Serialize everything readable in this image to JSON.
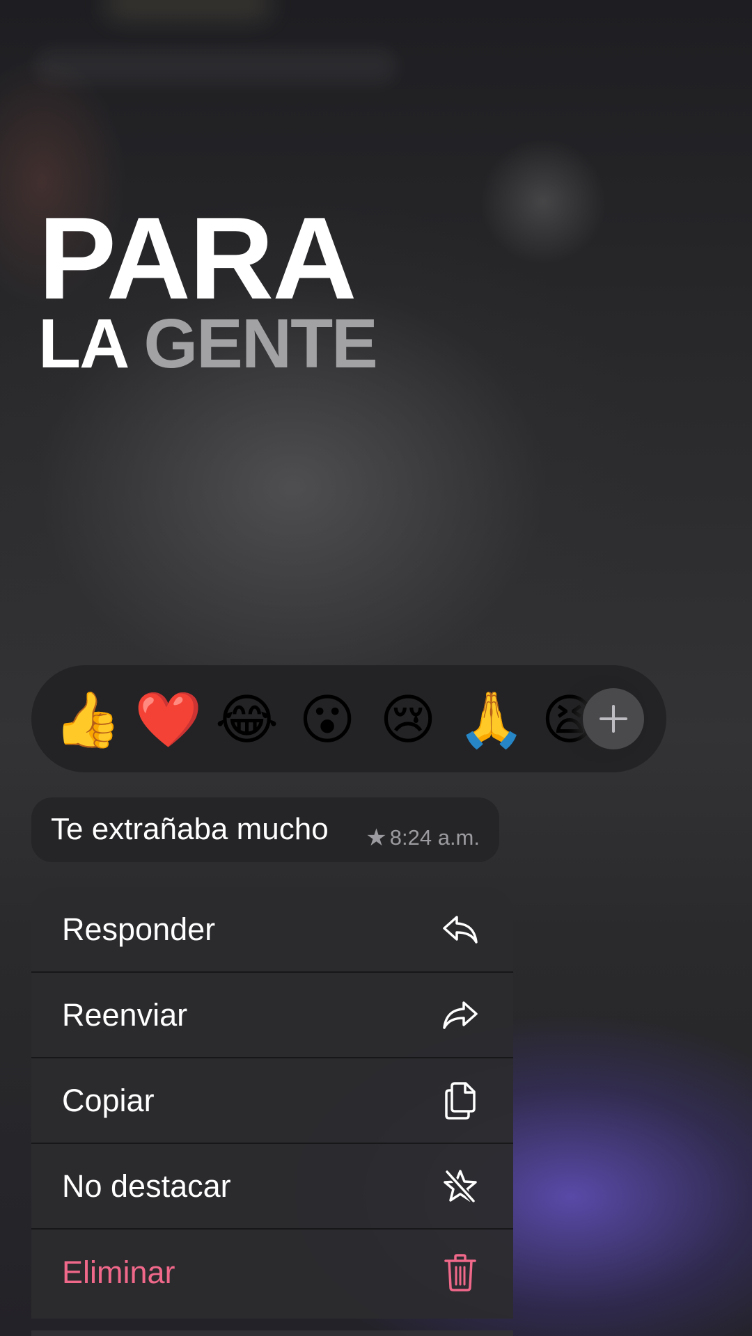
{
  "headline": {
    "line1": "PARA",
    "line2_a": "LA",
    "line2_b": "GENTE"
  },
  "reactions": {
    "items": [
      {
        "emoji": "👍",
        "name": "thumbs-up"
      },
      {
        "emoji": "❤️",
        "name": "red-heart"
      },
      {
        "emoji": "😂",
        "name": "tears-of-joy"
      },
      {
        "emoji": "😮",
        "name": "face-open-mouth"
      },
      {
        "emoji": "😢",
        "name": "crying-face"
      },
      {
        "emoji": "🙏",
        "name": "folded-hands"
      },
      {
        "emoji": "😫",
        "name": "tired-face"
      }
    ],
    "more_icon": "plus-icon"
  },
  "message": {
    "text": "Te extrañaba mucho",
    "starred": true,
    "time": "8:24 a.m."
  },
  "menu": {
    "items": [
      {
        "label": "Responder",
        "icon": "reply-icon"
      },
      {
        "label": "Reenviar",
        "icon": "forward-icon"
      },
      {
        "label": "Copiar",
        "icon": "copy-icon"
      },
      {
        "label": "No destacar",
        "icon": "unstar-icon"
      },
      {
        "label": "Eliminar",
        "icon": "trash-icon",
        "destructive": true
      }
    ]
  },
  "colors": {
    "destructive": "#f0688a",
    "menu_bg": "#2c2c2f",
    "bubble_bg": "#252527",
    "reaction_bar_bg": "#232325"
  }
}
